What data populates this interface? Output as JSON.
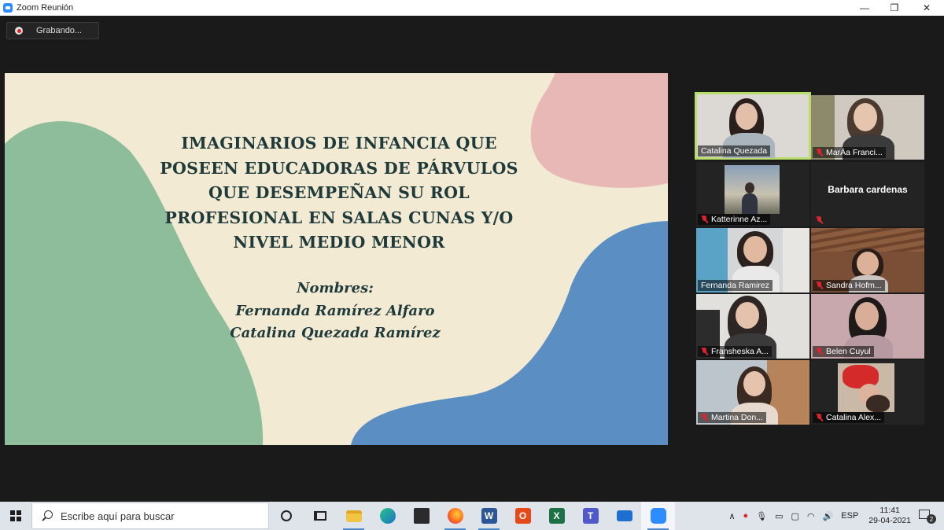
{
  "window": {
    "title": "Zoom Reunión",
    "minimize": "—",
    "maximize": "❐",
    "close": "✕"
  },
  "recording": {
    "label": "Grabando..."
  },
  "slide": {
    "title_lines": [
      "IMAGINARIOS DE INFANCIA QUE",
      "POSEEN EDUCADORAS DE PÁRVULOS",
      "QUE DESEMPEÑAN SU ROL",
      "PROFESIONAL EN SALAS CUNAS Y/O",
      "NIVEL MEDIO MENOR"
    ],
    "names_label": "Nombres:",
    "names": [
      "Fernanda Ramírez Alfaro",
      "Catalina Quezada Ramírez"
    ],
    "colors": {
      "background": "#f2ead2",
      "pink": "#e8b8b7",
      "green": "#8dbd9a",
      "blue": "#5b8fc4"
    }
  },
  "participants": [
    {
      "name": "Catalina Quezada",
      "muted": false,
      "active": true
    },
    {
      "name": "MarÁa Franci...",
      "muted": true,
      "active": false
    },
    {
      "name": "Katterinne Az...",
      "muted": true,
      "active": false
    },
    {
      "name": "Barbara cardenas",
      "muted": true,
      "active": false,
      "no_video": true
    },
    {
      "name": "Fernanda Ramirez",
      "muted": false,
      "active": false
    },
    {
      "name": "Sandra Hofm...",
      "muted": true,
      "active": false
    },
    {
      "name": "Fransheska A...",
      "muted": true,
      "active": false
    },
    {
      "name": "Belen Cuyul",
      "muted": true,
      "active": false
    },
    {
      "name": "Martina Don...",
      "muted": true,
      "active": false
    },
    {
      "name": "Catalina Alex...",
      "muted": true,
      "active": false
    }
  ],
  "taskbar": {
    "search_placeholder": "Escribe aquí para buscar",
    "apps": [
      "cortana-icon",
      "task-view-icon",
      "file-explorer-icon",
      "edge-icon",
      "store-icon",
      "firefox-icon",
      "word-icon",
      "office-icon",
      "excel-icon",
      "teams-icon",
      "mail-icon",
      "zoom-icon"
    ],
    "tray_language": "ESP",
    "time": "11:41",
    "date": "29-04-2021",
    "notification_count": "2"
  }
}
